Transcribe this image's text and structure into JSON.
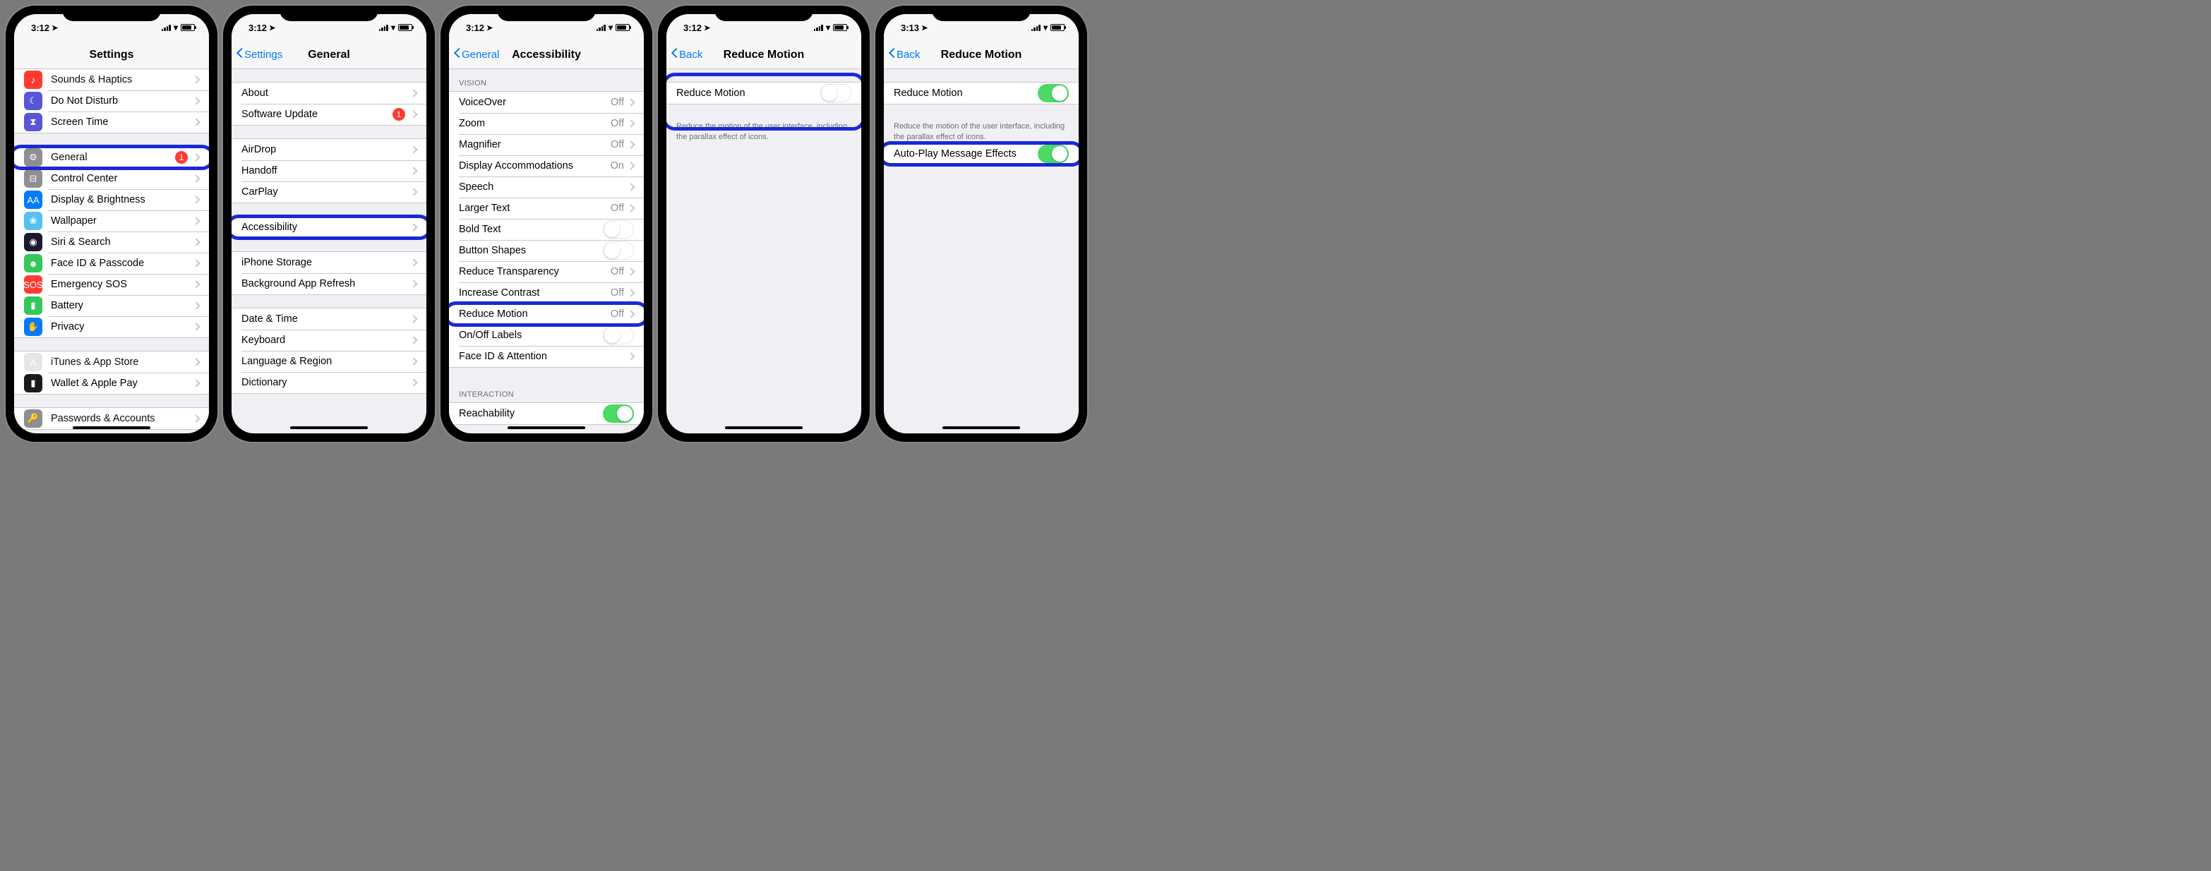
{
  "screens": [
    {
      "time": "3:12",
      "title": "Settings",
      "back": null,
      "groups": [
        {
          "rows": [
            {
              "icon": "#ff3b30",
              "glyph": "♪",
              "label": "Sounds & Haptics",
              "clipped": true
            },
            {
              "icon": "#5856d6",
              "glyph": "☾",
              "label": "Do Not Disturb"
            },
            {
              "icon": "#5856d6",
              "glyph": "⧗",
              "label": "Screen Time"
            }
          ]
        },
        {
          "rows": [
            {
              "icon": "#8e8e93",
              "glyph": "⚙",
              "label": "General",
              "badge": "1",
              "highlighted": true
            },
            {
              "icon": "#8e8e93",
              "glyph": "⊟",
              "label": "Control Center"
            },
            {
              "icon": "#007aff",
              "glyph": "AA",
              "label": "Display & Brightness"
            },
            {
              "icon": "#55c1ef",
              "glyph": "❀",
              "label": "Wallpaper"
            },
            {
              "icon": "#1a1a2e",
              "glyph": "◉",
              "label": "Siri & Search"
            },
            {
              "icon": "#34c759",
              "glyph": "☻",
              "label": "Face ID & Passcode"
            },
            {
              "icon": "#ff3b30",
              "glyph": "SOS",
              "label": "Emergency SOS"
            },
            {
              "icon": "#34c759",
              "glyph": "▮",
              "label": "Battery"
            },
            {
              "icon": "#007aff",
              "glyph": "✋",
              "label": "Privacy"
            }
          ]
        },
        {
          "rows": [
            {
              "icon": "#e6e6e6",
              "glyph": "A",
              "label": "iTunes & App Store"
            },
            {
              "icon": "#1a1a1a",
              "glyph": "▮",
              "label": "Wallet & Apple Pay"
            }
          ]
        },
        {
          "rows": [
            {
              "icon": "#8e8e93",
              "glyph": "🔑",
              "label": "Passwords & Accounts",
              "clipped": true
            }
          ]
        }
      ]
    },
    {
      "time": "3:12",
      "title": "General",
      "back": "Settings",
      "groups": [
        {
          "gap": true
        },
        {
          "rows": [
            {
              "label": "About"
            },
            {
              "label": "Software Update",
              "badge": "1"
            }
          ]
        },
        {
          "rows": [
            {
              "label": "AirDrop"
            },
            {
              "label": "Handoff"
            },
            {
              "label": "CarPlay"
            }
          ]
        },
        {
          "rows": [
            {
              "label": "Accessibility",
              "highlighted": true
            }
          ]
        },
        {
          "rows": [
            {
              "label": "iPhone Storage"
            },
            {
              "label": "Background App Refresh"
            }
          ]
        },
        {
          "rows": [
            {
              "label": "Date & Time"
            },
            {
              "label": "Keyboard"
            },
            {
              "label": "Language & Region"
            },
            {
              "label": "Dictionary"
            }
          ]
        }
      ]
    },
    {
      "time": "3:12",
      "title": "Accessibility",
      "back": "General",
      "groups": [
        {
          "header": "Vision",
          "rows": [
            {
              "label": "VoiceOver",
              "value": "Off"
            },
            {
              "label": "Zoom",
              "value": "Off"
            },
            {
              "label": "Magnifier",
              "value": "Off"
            },
            {
              "label": "Display Accommodations",
              "value": "On"
            },
            {
              "label": "Speech"
            },
            {
              "label": "Larger Text",
              "value": "Off"
            },
            {
              "label": "Bold Text",
              "switch": "off"
            },
            {
              "label": "Button Shapes",
              "switch": "off"
            },
            {
              "label": "Reduce Transparency",
              "value": "Off"
            },
            {
              "label": "Increase Contrast",
              "value": "Off"
            },
            {
              "label": "Reduce Motion",
              "value": "Off",
              "highlighted": true
            },
            {
              "label": "On/Off Labels",
              "switch": "off"
            },
            {
              "label": "Face ID & Attention"
            }
          ]
        },
        {
          "header": "Interaction",
          "rows": [
            {
              "label": "Reachability",
              "switch": "on"
            }
          ]
        }
      ]
    },
    {
      "time": "3:12",
      "title": "Reduce Motion",
      "back": "Back",
      "groups": [
        {
          "gap": true
        },
        {
          "rows": [
            {
              "label": "Reduce Motion",
              "switch": "off",
              "highlighted": true,
              "hlTall": true
            }
          ],
          "footer": "Reduce the motion of the user interface, including the parallax effect of icons."
        }
      ]
    },
    {
      "time": "3:13",
      "title": "Reduce Motion",
      "back": "Back",
      "groups": [
        {
          "gap": true
        },
        {
          "rows": [
            {
              "label": "Reduce Motion",
              "switch": "on"
            }
          ],
          "footer": "Reduce the motion of the user interface, including the parallax effect of icons."
        },
        {
          "rows": [
            {
              "label": "Auto-Play Message Effects",
              "switch": "on",
              "highlighted": true
            }
          ]
        }
      ]
    }
  ]
}
